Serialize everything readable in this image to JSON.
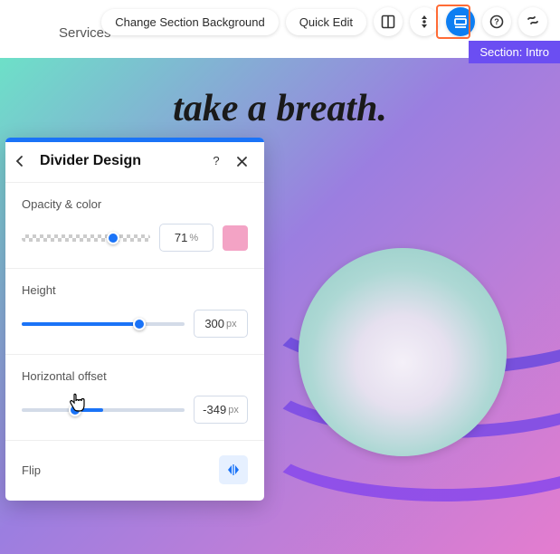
{
  "toolbar": {
    "change_bg_label": "Change Section Background",
    "quick_edit_label": "Quick Edit"
  },
  "nav": {
    "services_label": "Services"
  },
  "section_tag": "Section: Intro",
  "headline": "take a breath.",
  "panel": {
    "title": "Divider Design",
    "opacity": {
      "label": "Opacity & color",
      "value": "71",
      "unit": "%",
      "percent": 71,
      "swatch_color": "#f3a3c5"
    },
    "height": {
      "label": "Height",
      "value": "300",
      "unit": "px",
      "percent": 72
    },
    "offset": {
      "label": "Horizontal offset",
      "value": "-349",
      "unit": "px",
      "fill_start": 33,
      "fill_end": 50,
      "thumb": 33
    },
    "flip": {
      "label": "Flip"
    }
  }
}
